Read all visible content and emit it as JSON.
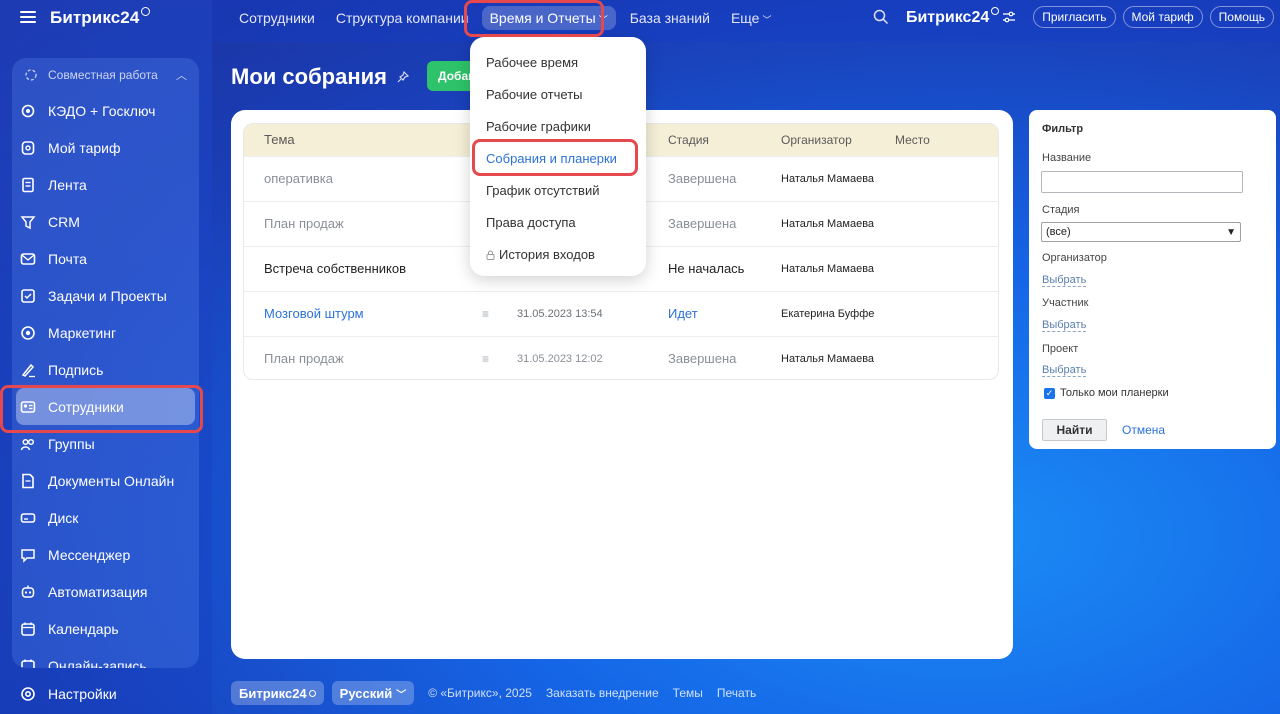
{
  "sidebar": {
    "logo": "Битрикс24",
    "group_label": "Совместная работа",
    "items": [
      {
        "label": "КЭДО + Госключ",
        "icon": "kedo-icon"
      },
      {
        "label": "Мой тариф",
        "icon": "tariff-icon"
      },
      {
        "label": "Лента",
        "icon": "feed-icon"
      },
      {
        "label": "CRM",
        "icon": "crm-icon"
      },
      {
        "label": "Почта",
        "icon": "mail-icon"
      },
      {
        "label": "Задачи и Проекты",
        "icon": "tasks-icon"
      },
      {
        "label": "Маркетинг",
        "icon": "marketing-icon"
      },
      {
        "label": "Подпись",
        "icon": "signature-icon"
      },
      {
        "label": "Сотрудники",
        "icon": "employees-icon",
        "active": true
      },
      {
        "label": "Группы",
        "icon": "groups-icon"
      },
      {
        "label": "Документы Онлайн",
        "icon": "documents-icon"
      },
      {
        "label": "Диск",
        "icon": "disk-icon"
      },
      {
        "label": "Мессенджер",
        "icon": "messenger-icon"
      },
      {
        "label": "Автоматизация",
        "icon": "automation-icon"
      },
      {
        "label": "Календарь",
        "icon": "calendar-icon"
      },
      {
        "label": "Онлайн-запись",
        "icon": "booking-icon"
      }
    ],
    "settings_label": "Настройки"
  },
  "topnav": {
    "items": [
      "Сотрудники",
      "Структура компании",
      "Время и Отчеты",
      "База знаний",
      "Еще"
    ],
    "selected": "Время и Отчеты",
    "right_logo": "Битрикс24",
    "invite": "Пригласить",
    "my_tariff": "Мой тариф",
    "help": "Помощь"
  },
  "page": {
    "title": "Мои собрания",
    "add_button": "Добавить"
  },
  "dropdown": {
    "items": [
      {
        "label": "Рабочее время"
      },
      {
        "label": "Рабочие отчеты"
      },
      {
        "label": "Рабочие графики"
      },
      {
        "label": "Собрания и планерки",
        "active": true
      },
      {
        "label": "График отсутствий"
      },
      {
        "label": "Права доступа"
      },
      {
        "label": "История входов",
        "locked": true
      }
    ]
  },
  "table": {
    "columns": {
      "topic": "Тема",
      "stage": "Стадия",
      "organizer": "Организатор",
      "place": "Место"
    },
    "rows": [
      {
        "topic": "оперативка",
        "date": "",
        "stage": "Завершена",
        "organizer": "Наталья Мамаева",
        "style": "muted"
      },
      {
        "topic": "План продаж",
        "date": "",
        "stage": "Завершена",
        "organizer": "Наталья Мамаева",
        "style": "muted"
      },
      {
        "topic": "Встреча собственников",
        "date": "",
        "stage": "Не началась",
        "organizer": "Наталья Мамаева",
        "style": "dark"
      },
      {
        "topic": "Мозговой штурм",
        "date": "31.05.2023 13:54",
        "stage": "Идет",
        "organizer": "Екатерина Буффе",
        "style": "link"
      },
      {
        "topic": "План продаж",
        "date": "31.05.2023 12:02",
        "stage": "Завершена",
        "organizer": "Наталья Мамаева",
        "style": "muted"
      }
    ]
  },
  "filter": {
    "title": "Фильтр",
    "name_label": "Название",
    "name_value": "",
    "stage_label": "Стадия",
    "stage_value": "(все)",
    "organizer_label": "Организатор",
    "participant_label": "Участник",
    "project_label": "Проект",
    "choose": "Выбрать",
    "only_mine": "Только мои планерки",
    "only_mine_checked": true,
    "find": "Найти",
    "cancel": "Отмена"
  },
  "footer": {
    "logo": "Битрикс24",
    "language": "Русский",
    "copyright": "© «Битрикс», 2025",
    "order": "Заказать внедрение",
    "themes": "Темы",
    "print": "Печать"
  },
  "colors": {
    "accent": "#2b72d8",
    "highlight": "#e5484d",
    "add_button": "#2ec36a",
    "table_head": "#f4efd6"
  }
}
